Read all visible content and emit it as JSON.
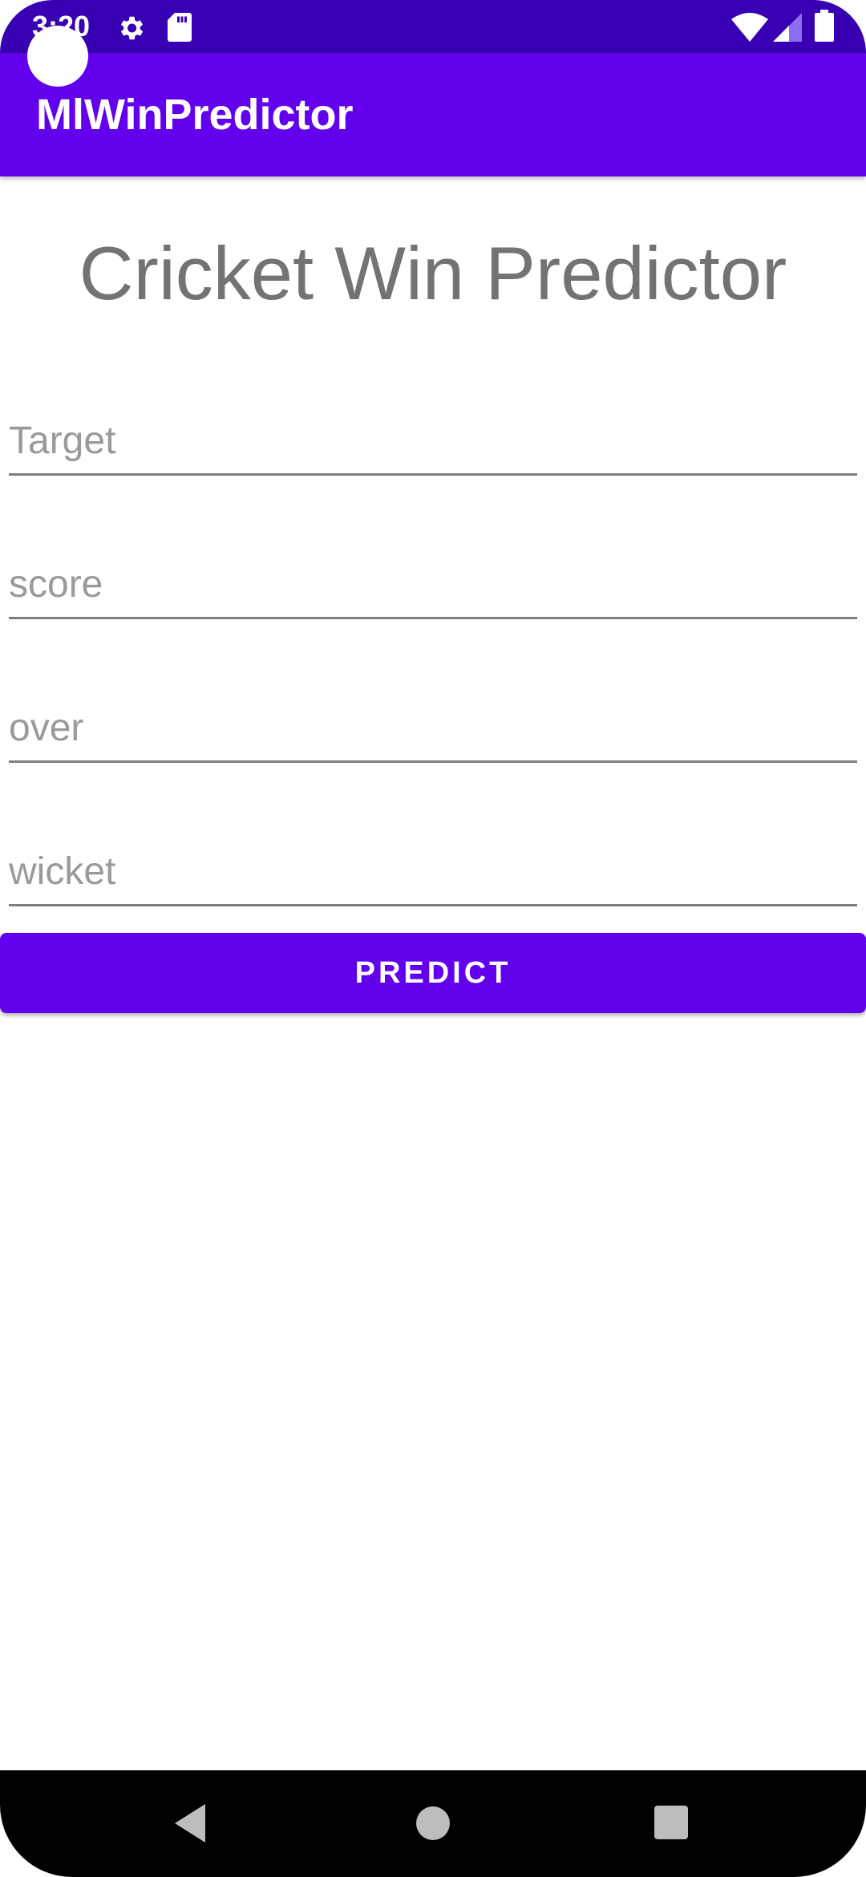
{
  "status_bar": {
    "time": "3:20",
    "icons": [
      "gear-icon",
      "sd-card-icon",
      "wifi-icon",
      "signal-icon",
      "battery-icon"
    ]
  },
  "app_bar": {
    "title": "MlWinPredictor"
  },
  "main": {
    "heading": "Cricket Win Predictor",
    "fields": {
      "target": {
        "placeholder": "Target",
        "value": ""
      },
      "score": {
        "placeholder": "score",
        "value": ""
      },
      "over": {
        "placeholder": "over",
        "value": ""
      },
      "wicket": {
        "placeholder": "wicket",
        "value": ""
      }
    },
    "predict_label": "PREDICT"
  },
  "nav_bar": {
    "icons": [
      "back-icon",
      "home-icon",
      "recents-icon"
    ]
  },
  "colors": {
    "status_bar": "#3700b3",
    "primary": "#6200ee",
    "heading_text": "#737373",
    "hint_text": "#9a9a9a"
  }
}
